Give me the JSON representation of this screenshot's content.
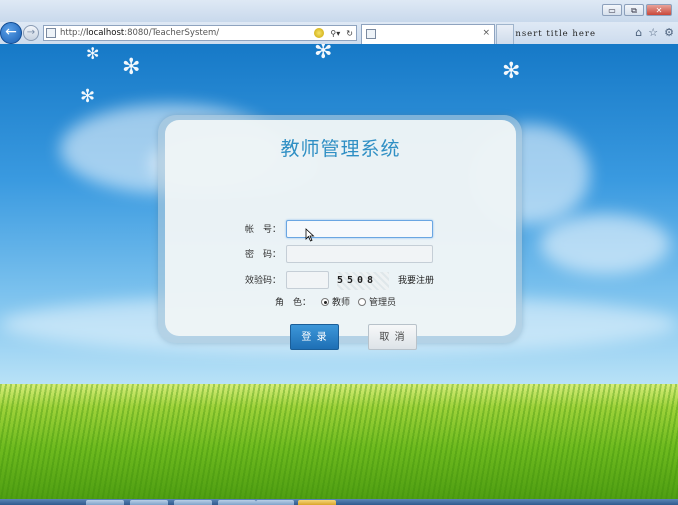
{
  "browser": {
    "url_prefix": "http://",
    "url_host": "localhost",
    "url_rest": ":8080/TeacherSystem/",
    "tab_title": "Insert title here",
    "tab_close": "×",
    "search_glyph": "⚲",
    "search_dropdown": "▾",
    "refresh_glyph": "↻",
    "back_glyph": "←",
    "forward_glyph": "→",
    "tools": {
      "home": "⌂",
      "favorites": "☆",
      "settings": "⚙"
    },
    "window_controls": {
      "minimize": "▭",
      "maximize": "⧉",
      "close": "✕"
    }
  },
  "login": {
    "title": "教师管理系统",
    "account_label": "帐　号：",
    "account_value": "",
    "password_label": "密　码：",
    "password_value": "",
    "captcha_label": "效验码：",
    "captcha_value": "",
    "captcha_code": "5508",
    "register_link": "我要注册",
    "role_label": "角　色：",
    "role_options": [
      "教师",
      "管理员"
    ],
    "role_selected": "教师",
    "login_button": "登 录",
    "cancel_button": "取 消"
  },
  "colors": {
    "title": "#2f8fc4",
    "primary_button": "#2a82c6",
    "sky_top": "#1679c7",
    "grass": "#6fbb1f"
  }
}
